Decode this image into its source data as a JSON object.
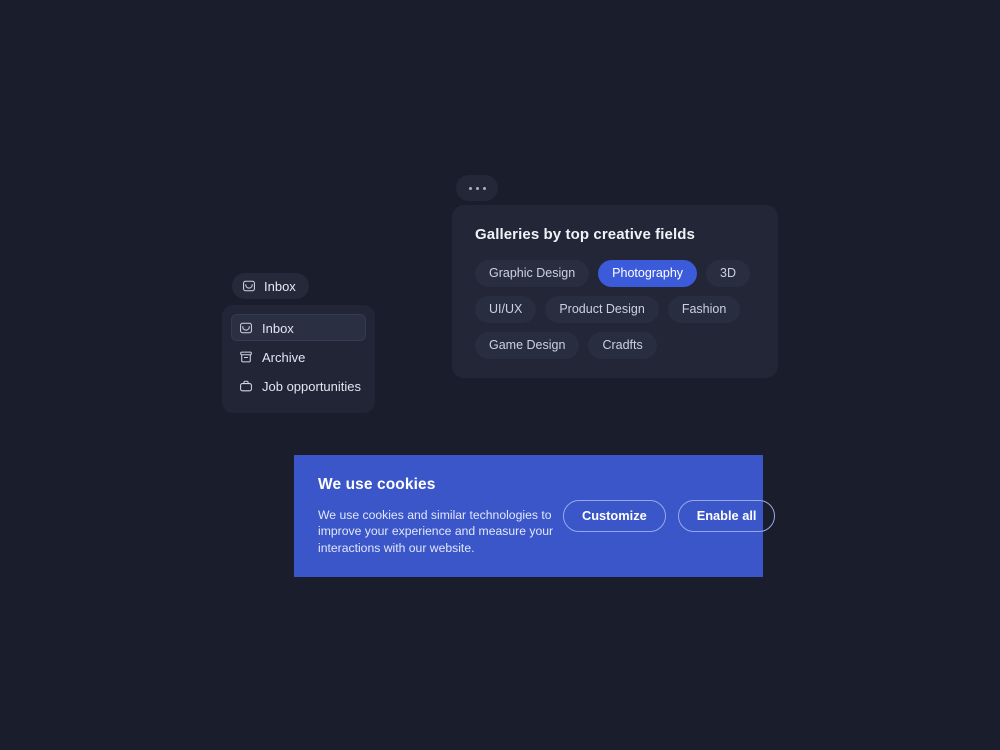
{
  "theme": {
    "page_background": "#1a1d2b",
    "card_background": "#222636",
    "chip_background": "#282d40",
    "accent_blue": "#3b5bdb",
    "banner_blue": "#3a56c9",
    "text_primary": "#f0f2f8",
    "text_secondary": "#ccd1e2"
  },
  "inbox_trigger": {
    "label": "Inbox",
    "icon": "inbox-tray-icon"
  },
  "inbox_menu": {
    "items": [
      {
        "label": "Inbox",
        "icon": "inbox-tray-icon",
        "selected": true
      },
      {
        "label": "Archive",
        "icon": "archive-box-icon",
        "selected": false
      },
      {
        "label": "Job opportunities",
        "icon": "briefcase-icon",
        "selected": false
      }
    ]
  },
  "overflow_button": {
    "label": "...",
    "icon": "ellipsis-horizontal-icon"
  },
  "gallery_card": {
    "title": "Galleries by top creative fields",
    "chips": [
      {
        "label": "Graphic Design",
        "selected": false
      },
      {
        "label": "Photography",
        "selected": true
      },
      {
        "label": "3D",
        "selected": false
      },
      {
        "label": "UI/UX",
        "selected": false
      },
      {
        "label": "Product Design",
        "selected": false
      },
      {
        "label": "Fashion",
        "selected": false
      },
      {
        "label": "Game Design",
        "selected": false
      },
      {
        "label": "Cradfts",
        "selected": false
      }
    ]
  },
  "cookie_banner": {
    "title": "We use cookies",
    "body": "We use cookies and similar technologies to improve your experience and measure your interactions with our website.",
    "customize_label": "Customize",
    "enable_all_label": "Enable all"
  }
}
